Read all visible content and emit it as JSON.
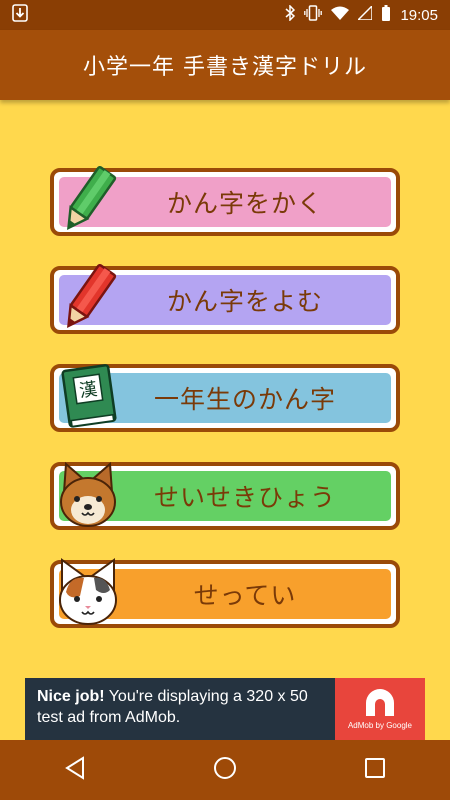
{
  "status_bar": {
    "time": "19:05",
    "icons": [
      "download-icon",
      "bluetooth-icon",
      "vibrate-icon",
      "wifi-icon",
      "signal-icon",
      "battery-icon"
    ]
  },
  "app_bar": {
    "title": "小学一年 手書き漢字ドリル"
  },
  "menu": [
    {
      "label": "かん字をかく",
      "color": "#f0a0c8",
      "icon": "green-pencil-icon"
    },
    {
      "label": "かん字をよむ",
      "color": "#b4a4f2",
      "icon": "red-pencil-icon"
    },
    {
      "label": "一年生のかん字",
      "color": "#84c4de",
      "icon": "kanji-book-icon",
      "icon_text": "漢"
    },
    {
      "label": "せいせきひょう",
      "color": "#64d064",
      "icon": "dog-face-icon"
    },
    {
      "label": "せってい",
      "color": "#f8a02c",
      "icon": "cat-face-icon"
    }
  ],
  "ad": {
    "headline": "Nice job!",
    "body": "You're displaying a 320 x 50 test ad from AdMob.",
    "badge": "AdMob by Google"
  },
  "nav_bar": {
    "icons": [
      "back-icon",
      "home-icon",
      "recents-icon"
    ]
  },
  "colors": {
    "background": "#ffd84d",
    "app_bar": "#a44f0a",
    "status_bar": "#8a3e04",
    "button_border": "#9a4a08"
  }
}
